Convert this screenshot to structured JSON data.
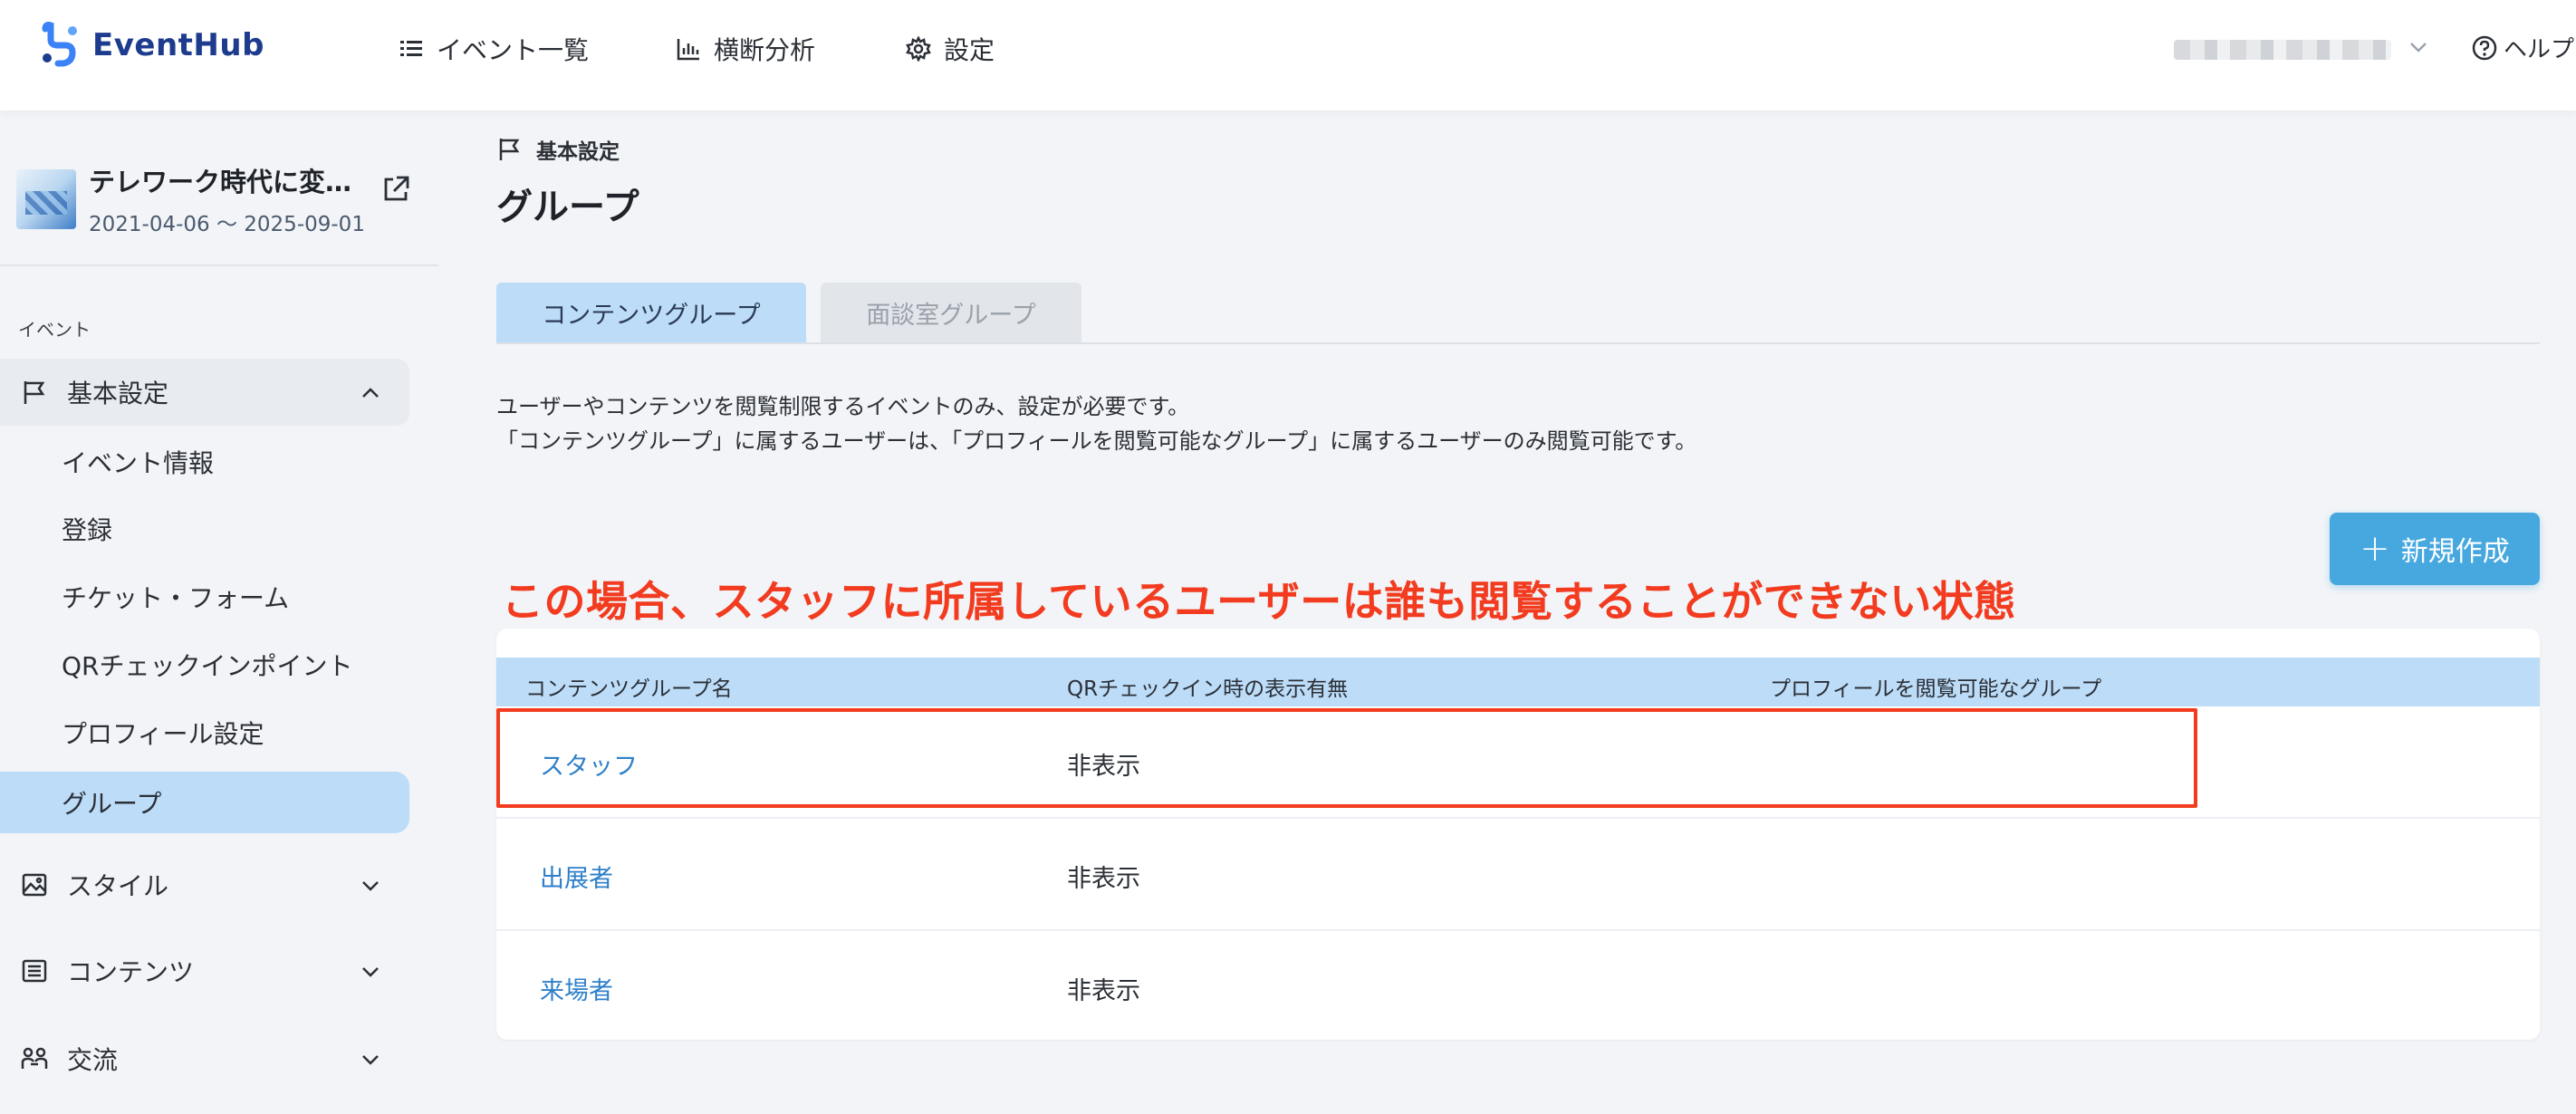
{
  "app": {
    "brand": "EventHub"
  },
  "topnav": [
    {
      "label": "イベント一覧",
      "icon": "list-icon"
    },
    {
      "label": "横断分析",
      "icon": "bar-chart-icon"
    },
    {
      "label": "設定",
      "icon": "gear-icon"
    }
  ],
  "help_label": "ヘルプ",
  "event": {
    "title": "テレワーク時代に変…",
    "dates": "2021-04-06 〜 2025-09-01"
  },
  "sidebar": {
    "section_label": "イベント",
    "basic_settings": "基本設定",
    "basic_items": [
      "イベント情報",
      "登録",
      "チケット・フォーム",
      "QRチェックインポイント",
      "プロフィール設定",
      "グループ"
    ],
    "style": "スタイル",
    "contents": "コンテンツ",
    "exchange": "交流"
  },
  "breadcrumb": "基本設定",
  "page_title": "グループ",
  "tabs": {
    "content_group": "コンテンツグループ",
    "meeting_group": "面談室グループ"
  },
  "description": {
    "line1": "ユーザーやコンテンツを閲覧制限するイベントのみ、設定が必要です。",
    "line2": "「コンテンツグループ」に属するユーザーは、「プロフィールを閲覧可能なグループ」に属するユーザーのみ閲覧可能です。"
  },
  "new_button": "新規作成",
  "annotation": "この場合、スタッフに所属しているユーザーは誰も閲覧することができない状態",
  "table": {
    "headers": [
      "コンテンツグループ名",
      "QRチェックイン時の表示有無",
      "プロフィールを閲覧可能なグループ"
    ],
    "rows": [
      {
        "name": "スタッフ",
        "qr": "非表示",
        "profile": ""
      },
      {
        "name": "出展者",
        "qr": "非表示",
        "profile": ""
      },
      {
        "name": "来場者",
        "qr": "非表示",
        "profile": ""
      }
    ]
  },
  "colors": {
    "accent": "#47a8e0",
    "active_bg": "#bcdcf8",
    "annotation": "#f23b1f",
    "brand": "#1d3c8e"
  }
}
